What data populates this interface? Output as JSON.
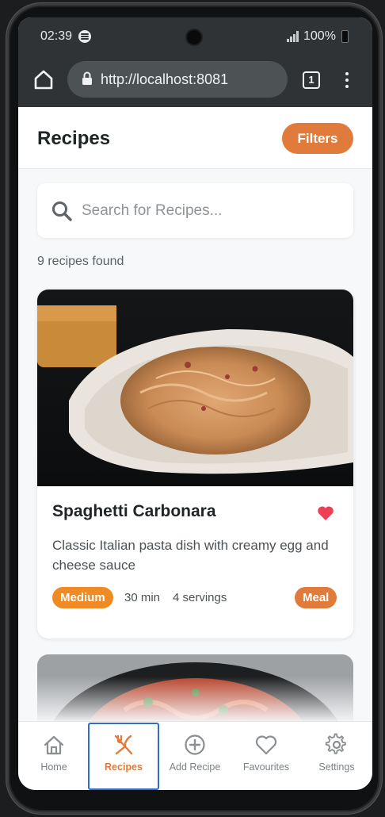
{
  "status_bar": {
    "time": "02:39",
    "battery": "100%"
  },
  "browser": {
    "url": "http://localhost:8081",
    "tab_count": "1"
  },
  "header": {
    "title": "Recipes",
    "filters_label": "Filters"
  },
  "search": {
    "placeholder": "Search for Recipes..."
  },
  "results": {
    "count_text": "9 recipes found"
  },
  "recipes": [
    {
      "title": "Spaghetti Carbonara",
      "description": "Classic Italian pasta dish with creamy egg and cheese sauce",
      "difficulty": "Medium",
      "time": "30 min",
      "servings": "4 servings",
      "category": "Meal",
      "favourite": true
    }
  ],
  "nav": [
    {
      "label": "Home",
      "icon": "home-icon"
    },
    {
      "label": "Recipes",
      "icon": "utensils-icon",
      "active": true
    },
    {
      "label": "Add Recipe",
      "icon": "plus-circle-icon"
    },
    {
      "label": "Favourites",
      "icon": "heart-outline-icon"
    },
    {
      "label": "Settings",
      "icon": "gear-icon"
    }
  ],
  "colors": {
    "accent": "#e07b3c",
    "difficulty": "#f08a24",
    "heart": "#ef3e56",
    "browser_bar": "#2f3335"
  }
}
